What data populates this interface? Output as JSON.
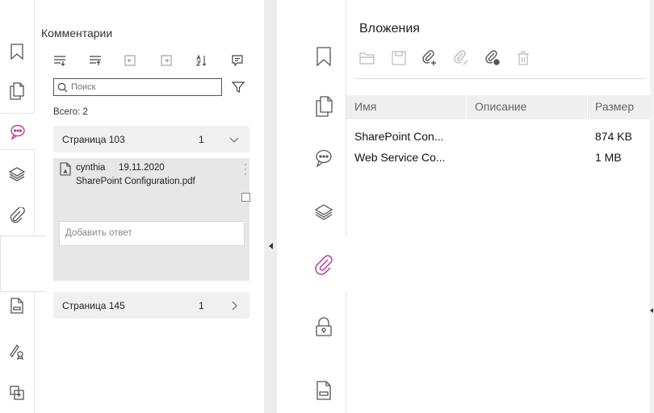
{
  "colors": {
    "accent": "#b2409a",
    "icon": "#555555",
    "muted": "#bbbbbb"
  },
  "left_rail": {
    "icons": [
      "bookmark-icon",
      "pages-icon",
      "comments-icon",
      "layers-icon",
      "attachment-icon",
      "lock-icon",
      "form-icon",
      "signature-icon",
      "compare-icon"
    ],
    "active": "comments-icon"
  },
  "comments": {
    "title": "Комментарии",
    "toolbar": [
      "expand-all-icon",
      "collapse-all-icon",
      "previous-icon",
      "next-icon",
      "sort-icon",
      "add-comment-icon"
    ],
    "search_placeholder": "Поиск",
    "total": "Всего: 2",
    "pages": [
      {
        "label": "Страница 103",
        "count": "1",
        "expanded": true
      },
      {
        "label": "Страница 145",
        "count": "1",
        "expanded": false
      }
    ],
    "comment": {
      "author": "cynthia",
      "date": "19.11.2020",
      "file": "SharePoint Configuration.pdf"
    },
    "reply_placeholder": "Добавить ответ"
  },
  "right_rail": {
    "icons": [
      "bookmark-icon",
      "pages-icon",
      "comments-icon",
      "layers-icon",
      "attachment-icon",
      "lock-icon",
      "form-icon"
    ],
    "active": "attachment-icon"
  },
  "attachments": {
    "title": "Вложения",
    "toolbar": [
      "open-icon",
      "save-icon",
      "add-attachment-icon",
      "edit-attachment-icon",
      "attachment-link-icon",
      "delete-icon"
    ],
    "columns": [
      "Имя",
      "Описание",
      "Размер"
    ],
    "rows": [
      {
        "name": "SharePoint Con...",
        "description": "",
        "size": "874 KB"
      },
      {
        "name": "Web Service Co...",
        "description": "",
        "size": "1 MB"
      }
    ]
  }
}
